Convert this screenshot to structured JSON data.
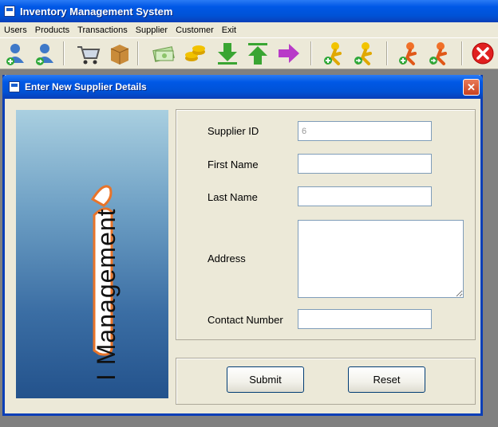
{
  "app": {
    "title": "Inventory Management System"
  },
  "menu": [
    "Users",
    "Products",
    "Transactions",
    "Supplier",
    "Customer",
    "Exit"
  ],
  "toolbar": [
    {
      "icon": "add-user-icon"
    },
    {
      "icon": "view-user-icon"
    },
    {
      "icon": "shopping-cart-icon"
    },
    {
      "icon": "product-box-icon"
    },
    {
      "icon": "cash-icon"
    },
    {
      "icon": "coins-icon"
    },
    {
      "icon": "arrow-down-icon"
    },
    {
      "icon": "arrow-up-icon"
    },
    {
      "icon": "arrow-right-icon"
    },
    {
      "icon": "add-supplier-icon"
    },
    {
      "icon": "view-supplier-icon"
    },
    {
      "icon": "add-customer-icon"
    },
    {
      "icon": "view-customer-icon"
    },
    {
      "icon": "exit-icon"
    }
  ],
  "dialog": {
    "title": "Enter New Supplier Details",
    "logo_text": "I Management",
    "fields": {
      "supplier_id": {
        "label": "Supplier ID",
        "value": "6"
      },
      "first_name": {
        "label": "First Name",
        "value": ""
      },
      "last_name": {
        "label": "Last Name",
        "value": ""
      },
      "address": {
        "label": "Address",
        "value": ""
      },
      "contact_number": {
        "label": "Contact Number",
        "value": ""
      }
    },
    "buttons": {
      "submit": "Submit",
      "reset": "Reset"
    }
  }
}
